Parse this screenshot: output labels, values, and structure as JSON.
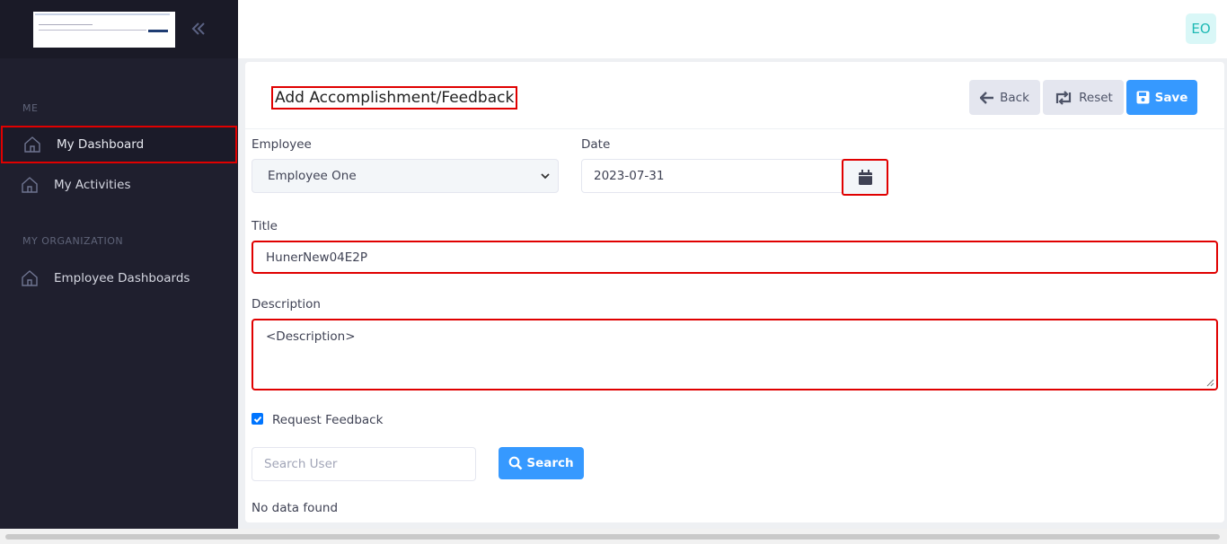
{
  "sidebar": {
    "sections": [
      {
        "label": "ME"
      },
      {
        "label": "MY ORGANIZATION"
      }
    ],
    "items": [
      {
        "label": "My Dashboard",
        "icon": "home-icon"
      },
      {
        "label": "My Activities",
        "icon": "home-icon"
      },
      {
        "label": "Employee Dashboards",
        "icon": "home-icon"
      }
    ],
    "collapse_icon": "double-chevron-left-icon"
  },
  "topbar": {
    "avatar_initials": "EO"
  },
  "form": {
    "title": "Add Accomplishment/Feedback",
    "buttons": {
      "back": "Back",
      "reset": "Reset",
      "save": "Save"
    },
    "employee": {
      "label": "Employee",
      "value": "Employee One"
    },
    "date": {
      "label": "Date",
      "value": "2023-07-31"
    },
    "title_field": {
      "label": "Title",
      "value": "HunerNew04E2P"
    },
    "description": {
      "label": "Description",
      "value": "<Description>"
    },
    "request_feedback": {
      "label": "Request Feedback",
      "checked": true
    },
    "search": {
      "placeholder": "Search User",
      "button": "Search"
    },
    "empty_message": "No data found"
  },
  "colors": {
    "sidebar_bg": "#1f1f2e",
    "primary": "#3699ff",
    "highlight": "#e00000",
    "avatar_bg": "#d9f7f7",
    "avatar_fg": "#1fb9b4"
  }
}
